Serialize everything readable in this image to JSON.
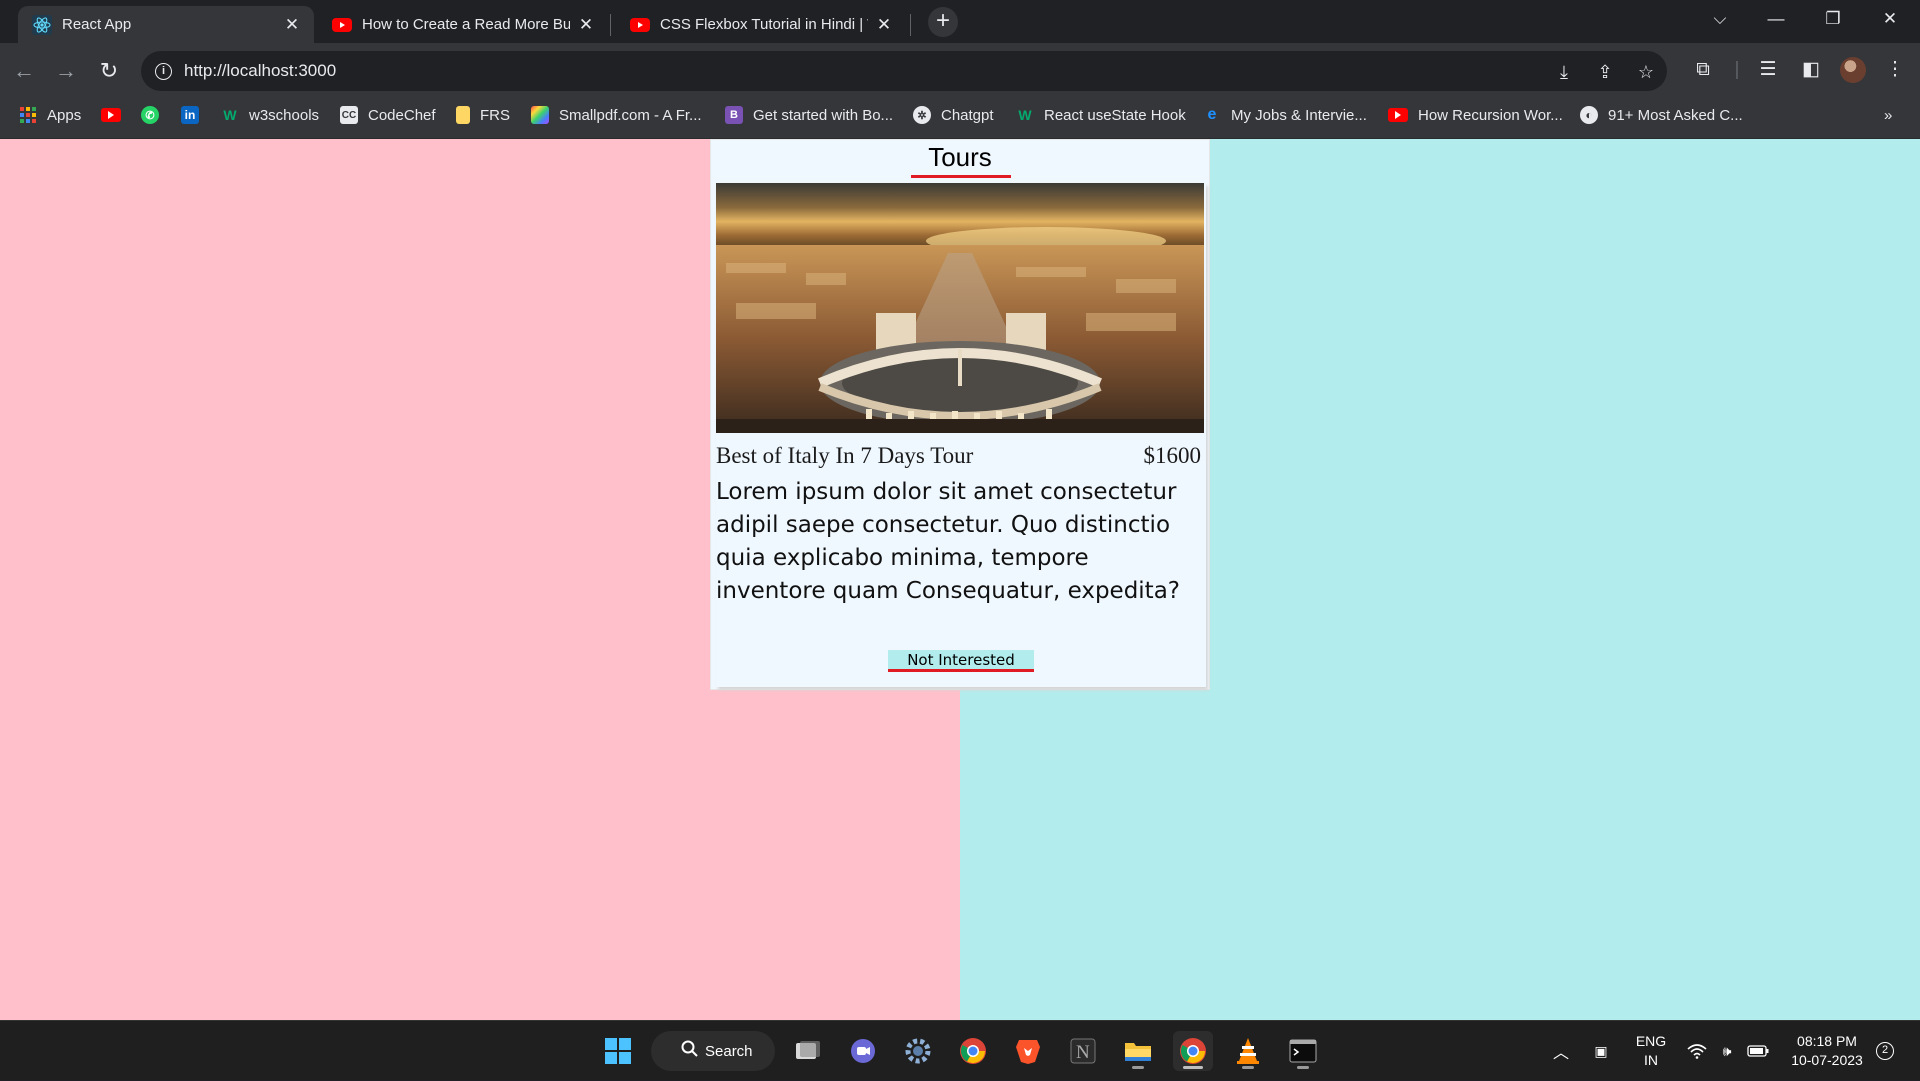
{
  "browser": {
    "tabs": [
      {
        "title": "React App",
        "icon": "react-icon",
        "active": true
      },
      {
        "title": "How to Create a Read More But",
        "icon": "youtube-icon",
        "active": false
      },
      {
        "title": "CSS Flexbox Tutorial in Hindi | W",
        "icon": "youtube-icon",
        "active": false
      }
    ],
    "url": "http://localhost:3000",
    "bookmarks": [
      {
        "label": "Apps",
        "icon": "apps-grid-icon"
      },
      {
        "label": "",
        "icon": "youtube-icon"
      },
      {
        "label": "",
        "icon": "whatsapp-icon"
      },
      {
        "label": "",
        "icon": "linkedin-icon"
      },
      {
        "label": "w3schools",
        "icon": "w3schools-icon"
      },
      {
        "label": "CodeChef",
        "icon": "codechef-icon"
      },
      {
        "label": "FRS",
        "icon": "folder-icon"
      },
      {
        "label": "Smallpdf.com - A Fr...",
        "icon": "smallpdf-icon"
      },
      {
        "label": "Get started with Bo...",
        "icon": "bootstrap-icon"
      },
      {
        "label": "Chatgpt",
        "icon": "chatgpt-icon"
      },
      {
        "label": "React useState Hook",
        "icon": "w3schools-icon"
      },
      {
        "label": "My Jobs & Intervie...",
        "icon": "edge-icon"
      },
      {
        "label": "How Recursion Wor...",
        "icon": "youtube-icon"
      },
      {
        "label": "91+ Most Asked C...",
        "icon": "globe-icon"
      }
    ],
    "overflow": "»"
  },
  "page": {
    "heading": "Tours",
    "tour": {
      "name": "Best of Italy In 7 Days Tour",
      "price": "$1600",
      "description": "Lorem ipsum dolor sit amet consectetur adipil saepe consectetur. Quo distinctio quia explicabo minima, tempore inventore quam Consequatur, expedita?",
      "button_label": "Not Interested",
      "image": "rome-st-peters-square-aerial-photo"
    },
    "colors": {
      "left_bg": "#ffc0cb",
      "right_bg": "#b2ecec",
      "card_bg": "#f0f8ff",
      "accent": "#e01b24"
    }
  },
  "taskbar": {
    "search_label": "Search",
    "language": {
      "line1": "ENG",
      "line2": "IN"
    },
    "time": "08:18 PM",
    "date": "10-07-2023",
    "notifications": "2"
  }
}
